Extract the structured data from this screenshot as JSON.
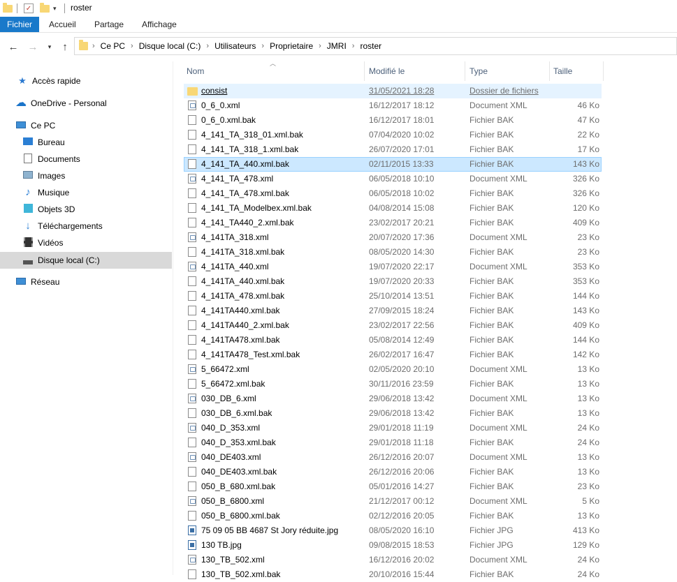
{
  "window": {
    "title": "roster"
  },
  "ribbon": {
    "tabs": [
      "Fichier",
      "Accueil",
      "Partage",
      "Affichage"
    ]
  },
  "address": {
    "crumbs": [
      "Ce PC",
      "Disque local (C:)",
      "Utilisateurs",
      "Proprietaire",
      "JMRI",
      "roster"
    ]
  },
  "sidebar": {
    "items": [
      {
        "label": "Accès rapide",
        "icon": "star-icon"
      },
      {
        "label": "OneDrive - Personal",
        "icon": "cloud-icon"
      },
      {
        "label": "Ce PC",
        "icon": "computer-icon"
      },
      {
        "label": "Bureau",
        "icon": "desktop-icon"
      },
      {
        "label": "Documents",
        "icon": "documents-icon"
      },
      {
        "label": "Images",
        "icon": "images-icon"
      },
      {
        "label": "Musique",
        "icon": "music-icon"
      },
      {
        "label": "Objets 3D",
        "icon": "cube-icon"
      },
      {
        "label": "Téléchargements",
        "icon": "download-icon"
      },
      {
        "label": "Vidéos",
        "icon": "video-icon"
      },
      {
        "label": "Disque local (C:)",
        "icon": "drive-icon"
      },
      {
        "label": "Réseau",
        "icon": "network-icon"
      }
    ]
  },
  "columns": {
    "name": "Nom",
    "date": "Modifié le",
    "type": "Type",
    "size": "Taille"
  },
  "files": [
    {
      "name": "consist",
      "date": "31/05/2021 18:28",
      "type": "Dossier de fichiers",
      "size": "",
      "icon": "folder"
    },
    {
      "name": "0_6_0.xml",
      "date": "16/12/2017 18:12",
      "type": "Document XML",
      "size": "46 Ko",
      "icon": "xml"
    },
    {
      "name": "0_6_0.xml.bak",
      "date": "16/12/2017 18:01",
      "type": "Fichier BAK",
      "size": "47 Ko",
      "icon": "bak"
    },
    {
      "name": "4_141_TA_318_01.xml.bak",
      "date": "07/04/2020 10:02",
      "type": "Fichier BAK",
      "size": "22 Ko",
      "icon": "bak"
    },
    {
      "name": "4_141_TA_318_1.xml.bak",
      "date": "26/07/2020 17:01",
      "type": "Fichier BAK",
      "size": "17 Ko",
      "icon": "bak"
    },
    {
      "name": "4_141_TA_440.xml.bak",
      "date": "02/11/2015 13:33",
      "type": "Fichier BAK",
      "size": "143 Ko",
      "icon": "bak"
    },
    {
      "name": "4_141_TA_478.xml",
      "date": "06/05/2018 10:10",
      "type": "Document XML",
      "size": "326 Ko",
      "icon": "xml"
    },
    {
      "name": "4_141_TA_478.xml.bak",
      "date": "06/05/2018 10:02",
      "type": "Fichier BAK",
      "size": "326 Ko",
      "icon": "bak"
    },
    {
      "name": "4_141_TA_Modelbex.xml.bak",
      "date": "04/08/2014 15:08",
      "type": "Fichier BAK",
      "size": "120 Ko",
      "icon": "bak"
    },
    {
      "name": "4_141_TA440_2.xml.bak",
      "date": "23/02/2017 20:21",
      "type": "Fichier BAK",
      "size": "409 Ko",
      "icon": "bak"
    },
    {
      "name": "4_141TA_318.xml",
      "date": "20/07/2020 17:36",
      "type": "Document XML",
      "size": "23 Ko",
      "icon": "xml"
    },
    {
      "name": "4_141TA_318.xml.bak",
      "date": "08/05/2020 14:30",
      "type": "Fichier BAK",
      "size": "23 Ko",
      "icon": "bak"
    },
    {
      "name": "4_141TA_440.xml",
      "date": "19/07/2020 22:17",
      "type": "Document XML",
      "size": "353 Ko",
      "icon": "xml"
    },
    {
      "name": "4_141TA_440.xml.bak",
      "date": "19/07/2020 20:33",
      "type": "Fichier BAK",
      "size": "353 Ko",
      "icon": "bak"
    },
    {
      "name": "4_141TA_478.xml.bak",
      "date": "25/10/2014 13:51",
      "type": "Fichier BAK",
      "size": "144 Ko",
      "icon": "bak"
    },
    {
      "name": "4_141TA440.xml.bak",
      "date": "27/09/2015 18:24",
      "type": "Fichier BAK",
      "size": "143 Ko",
      "icon": "bak"
    },
    {
      "name": "4_141TA440_2.xml.bak",
      "date": "23/02/2017 22:56",
      "type": "Fichier BAK",
      "size": "409 Ko",
      "icon": "bak"
    },
    {
      "name": "4_141TA478.xml.bak",
      "date": "05/08/2014 12:49",
      "type": "Fichier BAK",
      "size": "144 Ko",
      "icon": "bak"
    },
    {
      "name": "4_141TA478_Test.xml.bak",
      "date": "26/02/2017 16:47",
      "type": "Fichier BAK",
      "size": "142 Ko",
      "icon": "bak"
    },
    {
      "name": "5_66472.xml",
      "date": "02/05/2020 20:10",
      "type": "Document XML",
      "size": "13 Ko",
      "icon": "xml"
    },
    {
      "name": "5_66472.xml.bak",
      "date": "30/11/2016 23:59",
      "type": "Fichier BAK",
      "size": "13 Ko",
      "icon": "bak"
    },
    {
      "name": "030_DB_6.xml",
      "date": "29/06/2018 13:42",
      "type": "Document XML",
      "size": "13 Ko",
      "icon": "xml"
    },
    {
      "name": "030_DB_6.xml.bak",
      "date": "29/06/2018 13:42",
      "type": "Fichier BAK",
      "size": "13 Ko",
      "icon": "bak"
    },
    {
      "name": "040_D_353.xml",
      "date": "29/01/2018 11:19",
      "type": "Document XML",
      "size": "24 Ko",
      "icon": "xml"
    },
    {
      "name": "040_D_353.xml.bak",
      "date": "29/01/2018 11:18",
      "type": "Fichier BAK",
      "size": "24 Ko",
      "icon": "bak"
    },
    {
      "name": "040_DE403.xml",
      "date": "26/12/2016 20:07",
      "type": "Document XML",
      "size": "13 Ko",
      "icon": "xml"
    },
    {
      "name": "040_DE403.xml.bak",
      "date": "26/12/2016 20:06",
      "type": "Fichier BAK",
      "size": "13 Ko",
      "icon": "bak"
    },
    {
      "name": "050_B_680.xml.bak",
      "date": "05/01/2016 14:27",
      "type": "Fichier BAK",
      "size": "23 Ko",
      "icon": "bak"
    },
    {
      "name": "050_B_6800.xml",
      "date": "21/12/2017 00:12",
      "type": "Document XML",
      "size": "5 Ko",
      "icon": "xml"
    },
    {
      "name": "050_B_6800.xml.bak",
      "date": "02/12/2016 20:05",
      "type": "Fichier BAK",
      "size": "13 Ko",
      "icon": "bak"
    },
    {
      "name": "75 09 05 BB 4687 St Jory réduite.jpg",
      "date": "08/05/2020 16:10",
      "type": "Fichier JPG",
      "size": "413 Ko",
      "icon": "jpg"
    },
    {
      "name": "130 TB.jpg",
      "date": "09/08/2015 18:53",
      "type": "Fichier JPG",
      "size": "129 Ko",
      "icon": "jpg"
    },
    {
      "name": "130_TB_502.xml",
      "date": "16/12/2016 20:02",
      "type": "Document XML",
      "size": "24 Ko",
      "icon": "xml"
    },
    {
      "name": "130_TB_502.xml.bak",
      "date": "20/10/2016 15:44",
      "type": "Fichier BAK",
      "size": "24 Ko",
      "icon": "bak"
    }
  ],
  "state": {
    "hover_row": 0,
    "selected_row": 5
  }
}
